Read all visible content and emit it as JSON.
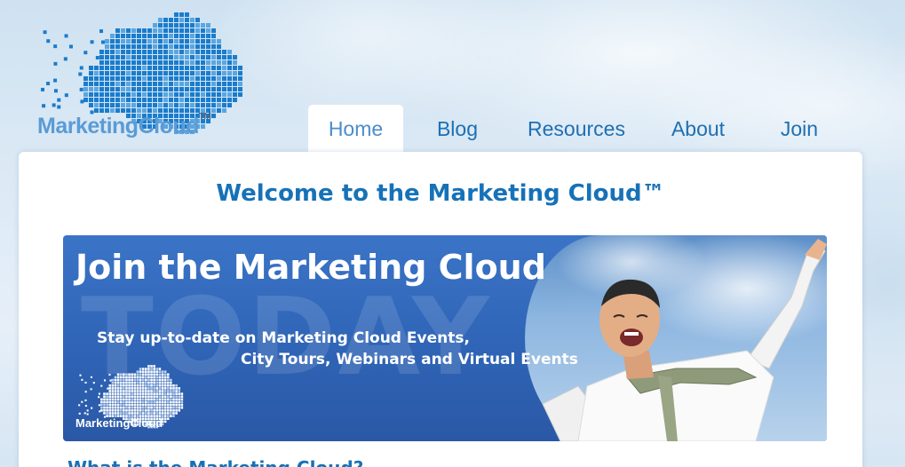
{
  "brand": {
    "logo_text": "MarketingCloud",
    "trademark": "TM"
  },
  "nav": {
    "items": [
      {
        "label": "Home",
        "active": true
      },
      {
        "label": "Blog",
        "active": false
      },
      {
        "label": "Resources",
        "active": false
      },
      {
        "label": "About",
        "active": false
      },
      {
        "label": "Join",
        "active": false
      }
    ]
  },
  "main": {
    "welcome_title": "Welcome to the Marketing Cloud™",
    "banner": {
      "title": "Join the Marketing Cloud",
      "watermark": "TODAY",
      "line1": "Stay up-to-date on Marketing Cloud Events,",
      "line2": "City Tours, Webinars and Virtual Events",
      "logo_text": "MarketingCloud"
    },
    "next_heading": "What is the Marketing Cloud?"
  },
  "colors": {
    "accent": "#1672b8",
    "nav_text": "#1e6fb3",
    "banner_blue": "#3068b8"
  }
}
